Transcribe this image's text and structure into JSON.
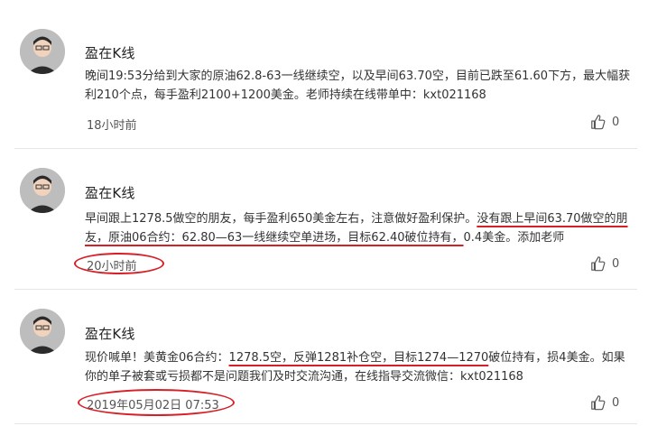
{
  "posts": [
    {
      "author": "盈在K线",
      "content": "晚间19:53分给到大家的原油62.8-63一线继续空，以及早间63.70空，目前已跌至61.60下方，最大幅获利210个点，每手盈利2100+1200美金。老师持续在线带单中：kxt021168",
      "time": "18小时前",
      "likes": "0"
    },
    {
      "author": "盈在K线",
      "content_a": "早间跟上1278.5做空的朋友，每手盈利650美金左右，注意做好盈利保护。",
      "content_b": "没有跟上早间63.70做空的朋友，原油06合约：62.80—63一线继续空单进场，目标62.40破位持有，",
      "content_c": "0.4美金。添加老师",
      "time": "20小时前",
      "likes": "0"
    },
    {
      "author": "盈在K线",
      "content_a": "现价喊单！美黄金06合约：",
      "content_b": "1278.5空，反弹1281补仓空，目标1274—1270",
      "content_c": "破位持有，损4美金。如果你的单子被套或亏损都不是问题我们及时交流沟通，在线指导交流微信：kxt021168",
      "time": "2019年05月02日 07:53",
      "likes": "0"
    }
  ],
  "colors": {
    "annotation": "#d61f26"
  }
}
